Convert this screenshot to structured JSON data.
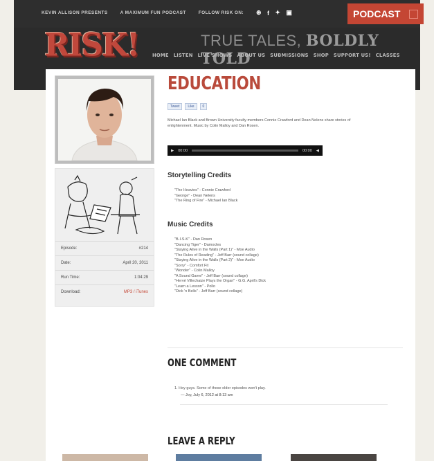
{
  "topbar": {
    "links": [
      "KEVIN ALLISON PRESENTS",
      "A MAXIMUM FUN PODCAST",
      "FOLLOW RISK ON:"
    ],
    "social_icons": [
      "rss-icon",
      "facebook-icon",
      "twitter-icon",
      "youtube-icon"
    ],
    "podcast_label": "PODCAST"
  },
  "masthead": {
    "logo": "RISK!",
    "tagline_light": "TRUE TALES,",
    "tagline_bold": "BOLDLY TOLD",
    "nav": [
      "HOME",
      "LISTEN",
      "LIVE SHOWS",
      "ABOUT US",
      "SUBMISSIONS",
      "SHOP",
      "SUPPORT US!",
      "CLASSES"
    ]
  },
  "episode": {
    "title": "EDUCATION",
    "share": [
      "Tweet",
      "Like",
      "0"
    ],
    "description": "Michael Ian Black and Brown University faculty members Connie Crawford and Dean Nelens share stories of enlightenment. Music by Colin Malloy and Dan Rosen.",
    "player": {
      "time_start": "00:00",
      "time_end": "00:00"
    },
    "meta": [
      {
        "label": "Episode:",
        "value": "#214"
      },
      {
        "label": "Date:",
        "value": "April 20, 2011"
      },
      {
        "label": "Run Time:",
        "value": "1:04:29"
      },
      {
        "label": "Download:",
        "value": "MP3 / iTunes"
      }
    ],
    "storytelling_heading": "Storytelling Credits",
    "storytelling": [
      "\"The Heavies\" - Connie Crawford",
      "\"George\" - Dean Nelens",
      "\"The Ring of Fire\" - Michael Ian Black"
    ],
    "music_heading": "Music Credits",
    "music": [
      "\"B-I-S-K\" - Dan Rosen",
      "\"Dancing Tiger\" - Damocles",
      "\"Staying Alive in the Walls (Part 1)\" - Moe Audio",
      "\"The Rules of Reading\" - Jeff Barr (sound collage)",
      "\"Staying Alive in the Walls (Part 2)\" - Moe Audio",
      "\"Sorry\" - Comfort Fit",
      "\"Wonder\" - Colin Malloy",
      "\"A Sound Game\" - Jeff Barr (sound collage)",
      "\"Hervé Villechaize Plays the Organ\" - G.G. April's Dick",
      "\"Learn a Lesson\" - Pollo",
      "\"Dick 'n Bells\" - Jeff Barr (sound collage)"
    ]
  },
  "comments": {
    "heading": "ONE COMMENT",
    "items": [
      {
        "number": "1.",
        "text": "Hey guys. Some of these older episodes won't play.",
        "author": "— Joy, July 6, 2012 at 8:13 am"
      }
    ]
  },
  "reply": {
    "heading": "LEAVE A REPLY"
  },
  "colors": {
    "accent": "#c44634",
    "dark": "#2b2b2b",
    "background": "#f1efe9"
  }
}
